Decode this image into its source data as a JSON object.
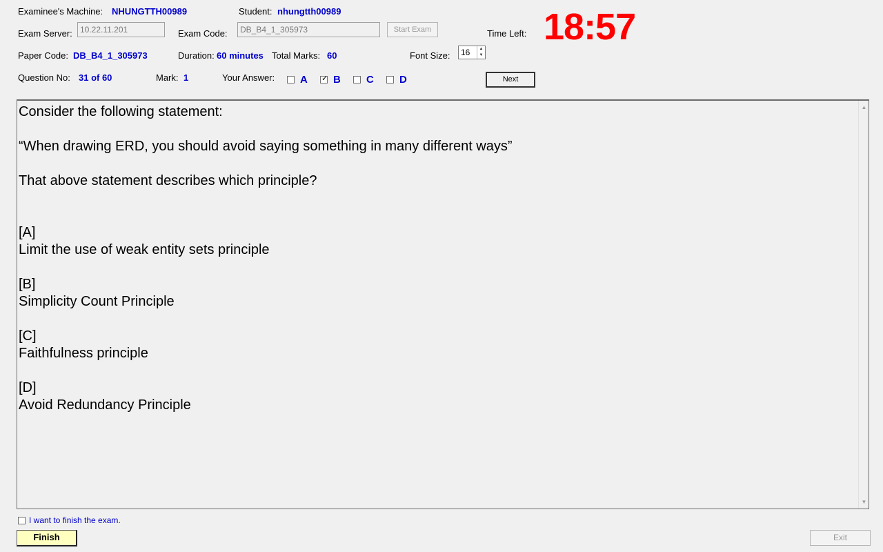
{
  "header": {
    "machine_label": "Examinee's Machine:",
    "machine_value": "NHUNGTTH00989",
    "student_label": "Student:",
    "student_value": "nhungtth00989",
    "server_label": "Exam Server:",
    "server_value": "10.22.11.201",
    "exam_code_label": "Exam Code:",
    "exam_code_value": "DB_B4_1_305973",
    "start_exam_label": "Start Exam",
    "time_left_label": "Time Left:",
    "time_left_value": "18:57",
    "paper_code_label": "Paper Code:",
    "paper_code_value": "DB_B4_1_305973",
    "duration_label": "Duration:",
    "duration_value": "60 minutes",
    "total_marks_label": "Total Marks:",
    "total_marks_value": "60",
    "font_size_label": "Font Size:",
    "font_size_value": "16",
    "question_no_label": "Question No:",
    "question_no_value": "31 of 60",
    "mark_label": "Mark:",
    "mark_value": "1",
    "your_answer_label": "Your Answer:",
    "next_label": "Next"
  },
  "answers": [
    {
      "letter": "A",
      "checked": false
    },
    {
      "letter": "B",
      "checked": true
    },
    {
      "letter": "C",
      "checked": false
    },
    {
      "letter": "D",
      "checked": false
    }
  ],
  "question": {
    "line1": "Consider the following statement:",
    "line2": "“When drawing ERD, you should avoid saying something in many different ways”",
    "line3": "That above statement describes which principle?",
    "options": [
      {
        "tag": "[A]",
        "text": "Limit the use of weak entity sets principle"
      },
      {
        "tag": "[B]",
        "text": "Simplicity Count Principle"
      },
      {
        "tag": "[C]",
        "text": "Faithfulness principle"
      },
      {
        "tag": "[D]",
        "text": "Avoid Redundancy Principle"
      }
    ]
  },
  "footer": {
    "finish_check_label": "I want to finish the exam.",
    "finish_label": "Finish",
    "exit_label": "Exit"
  }
}
